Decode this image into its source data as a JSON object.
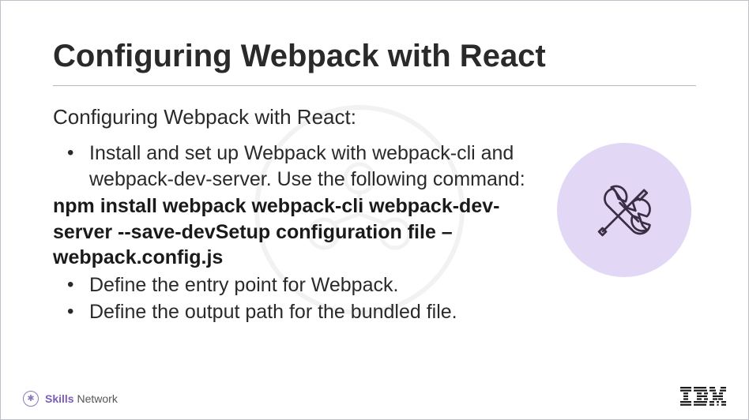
{
  "title": "Configuring Webpack with React",
  "subtitle": "Configuring Webpack with React:",
  "bullets": {
    "b1": "Install and set up Webpack with webpack-cli and webpack-dev-server. Use the following command:",
    "cmd": "npm install webpack webpack-cli webpack-dev-server --save-devSetup configuration file – webpack.config.js",
    "b2": "Define the entry point for Webpack.",
    "b3": "Define the output path for the bundled file."
  },
  "footer": {
    "skills": "Skills",
    "network": "Network",
    "ibm": "IBM"
  },
  "colors": {
    "accent_circle": "#e2d7f5",
    "icon_stroke": "#3a2d44",
    "skills_text": "#7a5db8"
  }
}
